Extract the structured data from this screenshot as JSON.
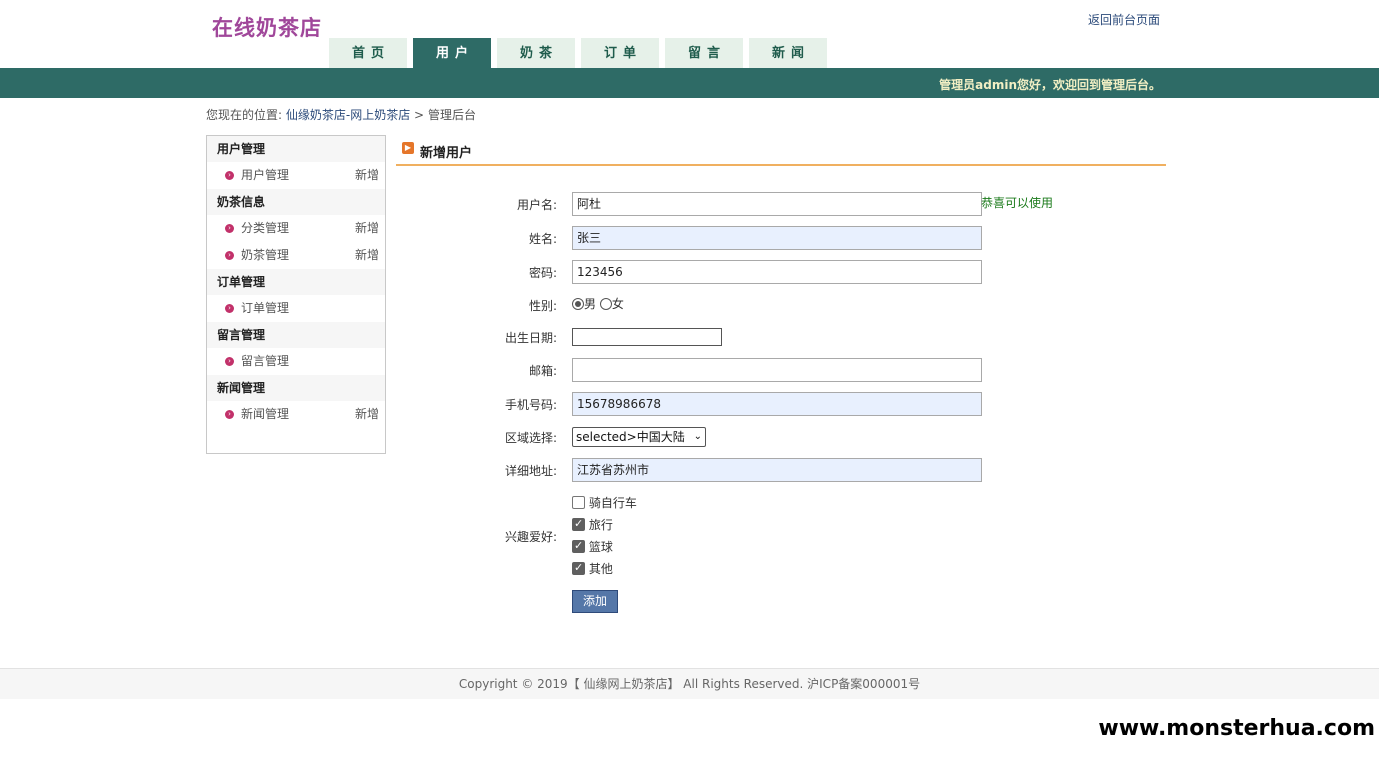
{
  "header": {
    "logo": "在线奶茶店",
    "back_link": "返回前台页面",
    "nav": [
      "首页",
      "用户",
      "奶茶",
      "订单",
      "留言",
      "新闻"
    ],
    "active_tab": "用户"
  },
  "topbar": {
    "welcome": "管理员admin您好，欢迎回到管理后台。"
  },
  "breadcrumb": {
    "prefix": "您现在的位置:",
    "site": "仙缘奶茶店-网上奶茶店",
    "sep": ">",
    "current": "管理后台"
  },
  "sidebar": {
    "groups": [
      {
        "title": "用户管理",
        "items": [
          {
            "label": "用户管理",
            "add": "新增"
          }
        ]
      },
      {
        "title": "奶茶信息",
        "items": [
          {
            "label": "分类管理",
            "add": "新增"
          },
          {
            "label": "奶茶管理",
            "add": "新增"
          }
        ]
      },
      {
        "title": "订单管理",
        "items": [
          {
            "label": "订单管理",
            "add": ""
          }
        ]
      },
      {
        "title": "留言管理",
        "items": [
          {
            "label": "留言管理",
            "add": ""
          }
        ]
      },
      {
        "title": "新闻管理",
        "items": [
          {
            "label": "新闻管理",
            "add": "新增"
          }
        ]
      }
    ]
  },
  "content": {
    "title": "新增用户",
    "form": {
      "username": {
        "label": "用户名:",
        "value": "阿杜",
        "hint": "恭喜可以使用"
      },
      "name": {
        "label": "姓名:",
        "value": "张三"
      },
      "password": {
        "label": "密码:",
        "value": "123456"
      },
      "gender": {
        "label": "性别:",
        "options": [
          "男",
          "女"
        ],
        "selected": "男"
      },
      "birthdate": {
        "label": "出生日期:",
        "value": ""
      },
      "email": {
        "label": "邮箱:",
        "value": ""
      },
      "phone": {
        "label": "手机号码:",
        "value": "15678986678"
      },
      "region": {
        "label": "区域选择:",
        "selected": "selected>中国大陆"
      },
      "address": {
        "label": "详细地址:",
        "value": "江苏省苏州市"
      },
      "hobbies": {
        "label": "兴趣爱好:",
        "options": [
          {
            "label": "骑自行车",
            "checked": false
          },
          {
            "label": "旅行",
            "checked": true
          },
          {
            "label": "篮球",
            "checked": true
          },
          {
            "label": "其他",
            "checked": true
          }
        ]
      },
      "submit_label": "添加"
    }
  },
  "footer": {
    "text": "Copyright © 2019【 仙缘网上奶茶店】 All Rights Reserved. 沪ICP备案000001号"
  },
  "watermark": "www.monsterhua.com",
  "colors": {
    "brand": "#a0479a",
    "bar": "#2e6b66",
    "accent": "#f0b060",
    "bullet": "#c2316a"
  }
}
